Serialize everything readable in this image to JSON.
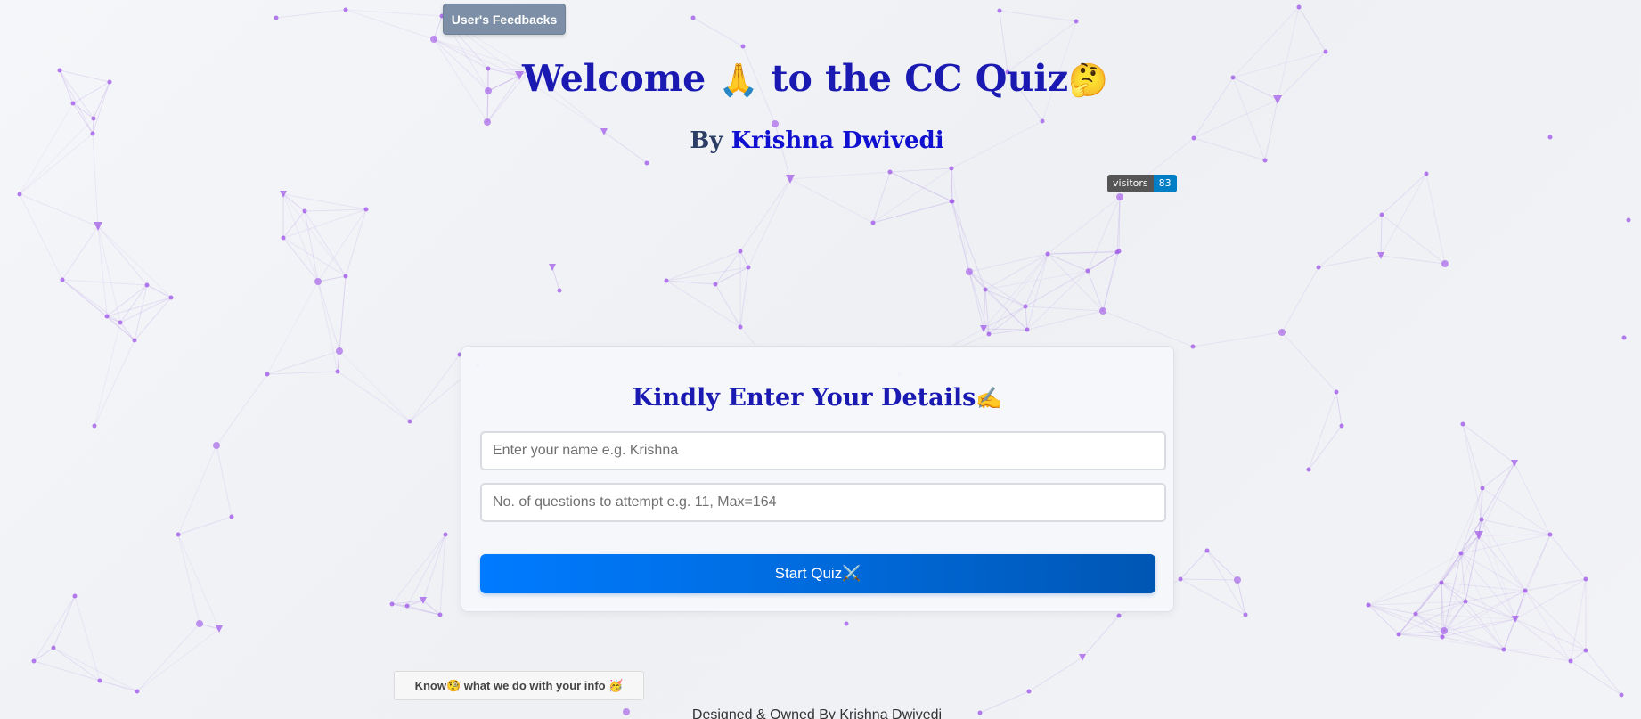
{
  "header": {
    "feedback_button": "User's Feedbacks",
    "title_part1": "Welcome",
    "title_emoji1": "🙏",
    "title_part2": "to the CC Quiz",
    "title_emoji2": "🤔",
    "byline_prefix": "By",
    "byline_author": "Krishna Dwivedi",
    "visitor_badge": {
      "label": "visitors",
      "count": "83"
    }
  },
  "form": {
    "title": "Kindly Enter Your Details",
    "title_emoji": "✍️",
    "name_placeholder": "Enter your name e.g. Krishna",
    "name_value": "",
    "questions_placeholder": "No. of questions to attempt e.g. 11, Max=164",
    "questions_value": "",
    "start_button": "Start Quiz⚔️"
  },
  "privacy_button": "Know🧐 what we do with your info 🥳",
  "footer": "Designed & Owned By Krishna Dwivedi",
  "colors": {
    "title": "#1a1ab3",
    "author": "#1010d0",
    "primary_button": "#007bff",
    "feedback_button": "#7d8fa6",
    "network_line": "#9b6ee0",
    "network_node": "#a35ce8"
  },
  "background": {
    "style": "particle-network"
  }
}
